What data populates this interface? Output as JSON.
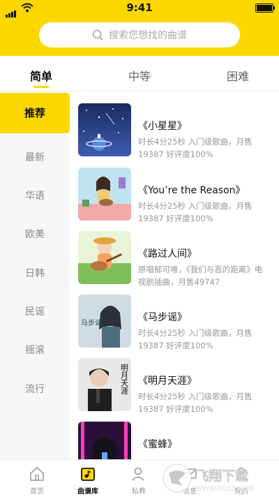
{
  "status": {
    "time": "9:41"
  },
  "search": {
    "placeholder": "搜索您想找的曲谱"
  },
  "tabs": [
    {
      "label": "简单",
      "active": true
    },
    {
      "label": "中等",
      "active": false
    },
    {
      "label": "困难",
      "active": false
    }
  ],
  "sidebar": {
    "items": [
      {
        "label": "推荐",
        "active": true
      },
      {
        "label": "最新"
      },
      {
        "label": "华语"
      },
      {
        "label": "欧美"
      },
      {
        "label": "日韩"
      },
      {
        "label": "民谣"
      },
      {
        "label": "摇滚"
      },
      {
        "label": "流行"
      }
    ]
  },
  "songs": [
    {
      "title": "《小星星》",
      "desc": "时长4分25秒 入门级歌曲，月售19387 好评度100%"
    },
    {
      "title": "《You’re the Reason》",
      "desc": "时长4分25秒 入门级歌曲，月售19387 好评度100%"
    },
    {
      "title": "《路过人间》",
      "desc": "原唱郁可唯，《我们与恶的距离》电视剧插曲，月售49747"
    },
    {
      "title": "《马步谣》",
      "desc": "时长4分25秒 入门级歌曲，月售19387 好评度100%"
    },
    {
      "title": "《明月天涯》",
      "desc": "时长4分25秒 入门级歌曲，月售19387 好评度100%"
    },
    {
      "title": "《蜜蜂》",
      "desc": ""
    }
  ],
  "thumb_text": {
    "song3": "马步谣",
    "song4": "明月天涯"
  },
  "bottom_nav": [
    {
      "label": "首页",
      "icon": "home-icon"
    },
    {
      "label": "曲谱库",
      "icon": "sheet-library-icon",
      "active": true
    },
    {
      "label": "私教",
      "icon": "tutor-icon"
    },
    {
      "label": "信息",
      "icon": "message-icon"
    },
    {
      "label": "我的",
      "icon": "profile-icon"
    }
  ],
  "watermark": {
    "brand": "飞翔下载",
    "url": "WWW.FXXZ.COM"
  },
  "colors": {
    "accent": "#fdd800",
    "sidebar_bg": "#f7f7f7",
    "text_muted": "#999999"
  }
}
